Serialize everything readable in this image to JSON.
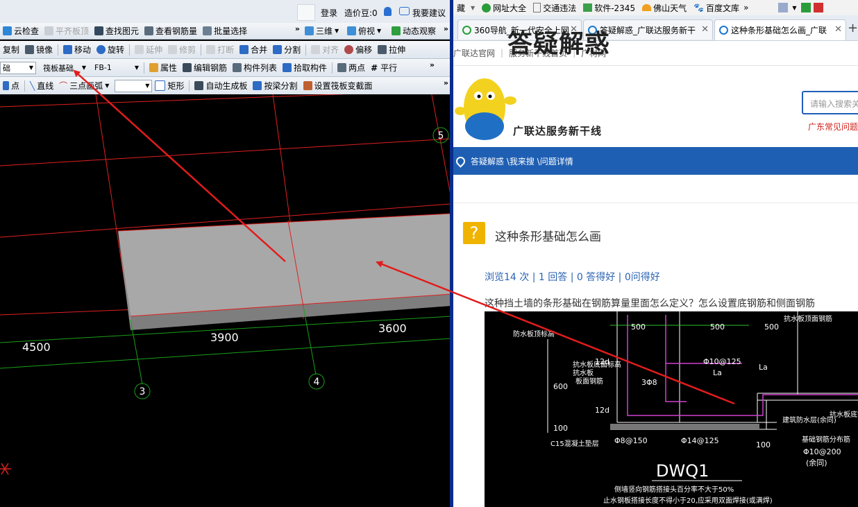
{
  "cad": {
    "topbar": {
      "login": "登录",
      "beans": "造价豆:0",
      "suggest": "我要建议"
    },
    "toolbar1": {
      "cloud_check": "云检查",
      "flat_slab": "平齐板顶",
      "find_elem": "查找图元",
      "view_rebar": "查看钢筋量",
      "batch_select": "批量选择",
      "three_d": "三维",
      "view_mode": "俯视",
      "dynamic": "动态观察"
    },
    "toolbar2": {
      "copy": "复制",
      "mirror": "镜像",
      "move": "移动",
      "rotate": "旋转",
      "extend": "延伸",
      "trim": "修剪",
      "break": "打断",
      "merge": "合并",
      "split": "分割",
      "align": "对齐",
      "offset": "偏移",
      "stretch": "拉伸"
    },
    "toolbar3": {
      "combo1": "础",
      "combo2": "筏板基础",
      "combo3": "FB-1",
      "properties": "属性",
      "edit_rebar": "编辑钢筋",
      "member_list": "构件列表",
      "pick": "拾取构件",
      "two_points": "两点",
      "parallel": "平行"
    },
    "toolbar4": {
      "point": "点",
      "line": "直线",
      "arc": "三点画弧",
      "rect": "矩形",
      "auto_slab": "自动生成板",
      "beam_split": "按梁分割",
      "set_section": "设置筏板变截面"
    },
    "axis_labels": [
      "3",
      "4",
      "5"
    ],
    "dimensions": [
      "4500",
      "3900",
      "3600"
    ]
  },
  "browser": {
    "favorites": [
      "藏",
      "网址大全",
      "交通违法",
      "软件-2345",
      "佛山天气",
      "百度文库"
    ],
    "tabs": [
      {
        "label": "360导航_新一代安全上网"
      },
      {
        "label": "答疑解惑_广联达服务新干"
      },
      {
        "label": "这种条形基础怎么画_广联"
      }
    ],
    "site_nav": [
      "广联达官网",
      "服务新干线首页",
      "广材网"
    ],
    "logo_title": "答疑解惑",
    "logo_sub": "广联达服务新干线",
    "search_placeholder": "请输入搜索关",
    "hot": "广东常见问题",
    "breadcrumb": "答疑解惑 \\我来搜 \\问题详情",
    "question_mark": "?",
    "question_title": "这种条形基础怎么画",
    "stats": "浏览14 次 | 1 回答 | 0 答得好 | 0问得好",
    "question_body": "这种挡土墙的条形基础在钢筋算量里面怎么定义？怎么设置底钢筋和侧面钢筋",
    "drawing": {
      "title": "DWQ1",
      "dims": [
        "500",
        "500",
        "500",
        "12d",
        "12d",
        "600",
        "100",
        "100",
        "La",
        "La"
      ],
      "rebars": [
        "Φ10@125",
        "3Φ8",
        "Φ8@150",
        "Φ14@125",
        "Φ10@200",
        "(余同)"
      ],
      "labels": [
        "防水板顶标高",
        "抗水板底面标高",
        "抗水板",
        "板面钢筋",
        "C15混凝土垫层",
        "建筑防水层(余同)",
        "抗水板底钢筋",
        "基础钢筋分布筋",
        "抗水板顶面钢筋"
      ],
      "notes": [
        "侧墙竖向钢筋搭接头百分率不大于50%",
        "止水钢板搭接长度不得小于20,应采用双面焊接(或满焊)"
      ]
    }
  }
}
